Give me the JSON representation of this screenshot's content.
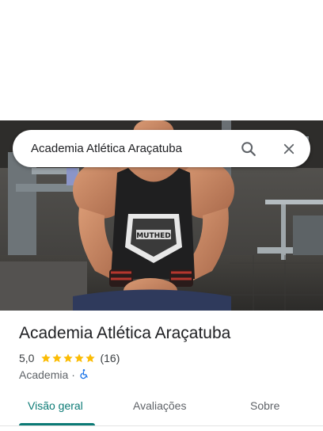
{
  "search": {
    "query": "Academia Atlética Araçatuba",
    "search_icon": "search-icon",
    "close_icon": "close-icon"
  },
  "hero": {
    "photo": "gym-photo",
    "shirt_logo_text": "MUTHED"
  },
  "place": {
    "title": "Academia Atlética Araçatuba",
    "rating": "5,0",
    "stars_count": 5,
    "reviews": "(16)",
    "category": "Academia",
    "separator": "·",
    "accessibility_icon": "wheelchair-icon"
  },
  "tabs": [
    {
      "label": "Visão geral",
      "active": true
    },
    {
      "label": "Avaliações",
      "active": false
    },
    {
      "label": "Sobre",
      "active": false
    }
  ],
  "colors": {
    "accent": "#0b7a75",
    "star": "#fbbc04",
    "accessibility": "#1a73e8"
  }
}
